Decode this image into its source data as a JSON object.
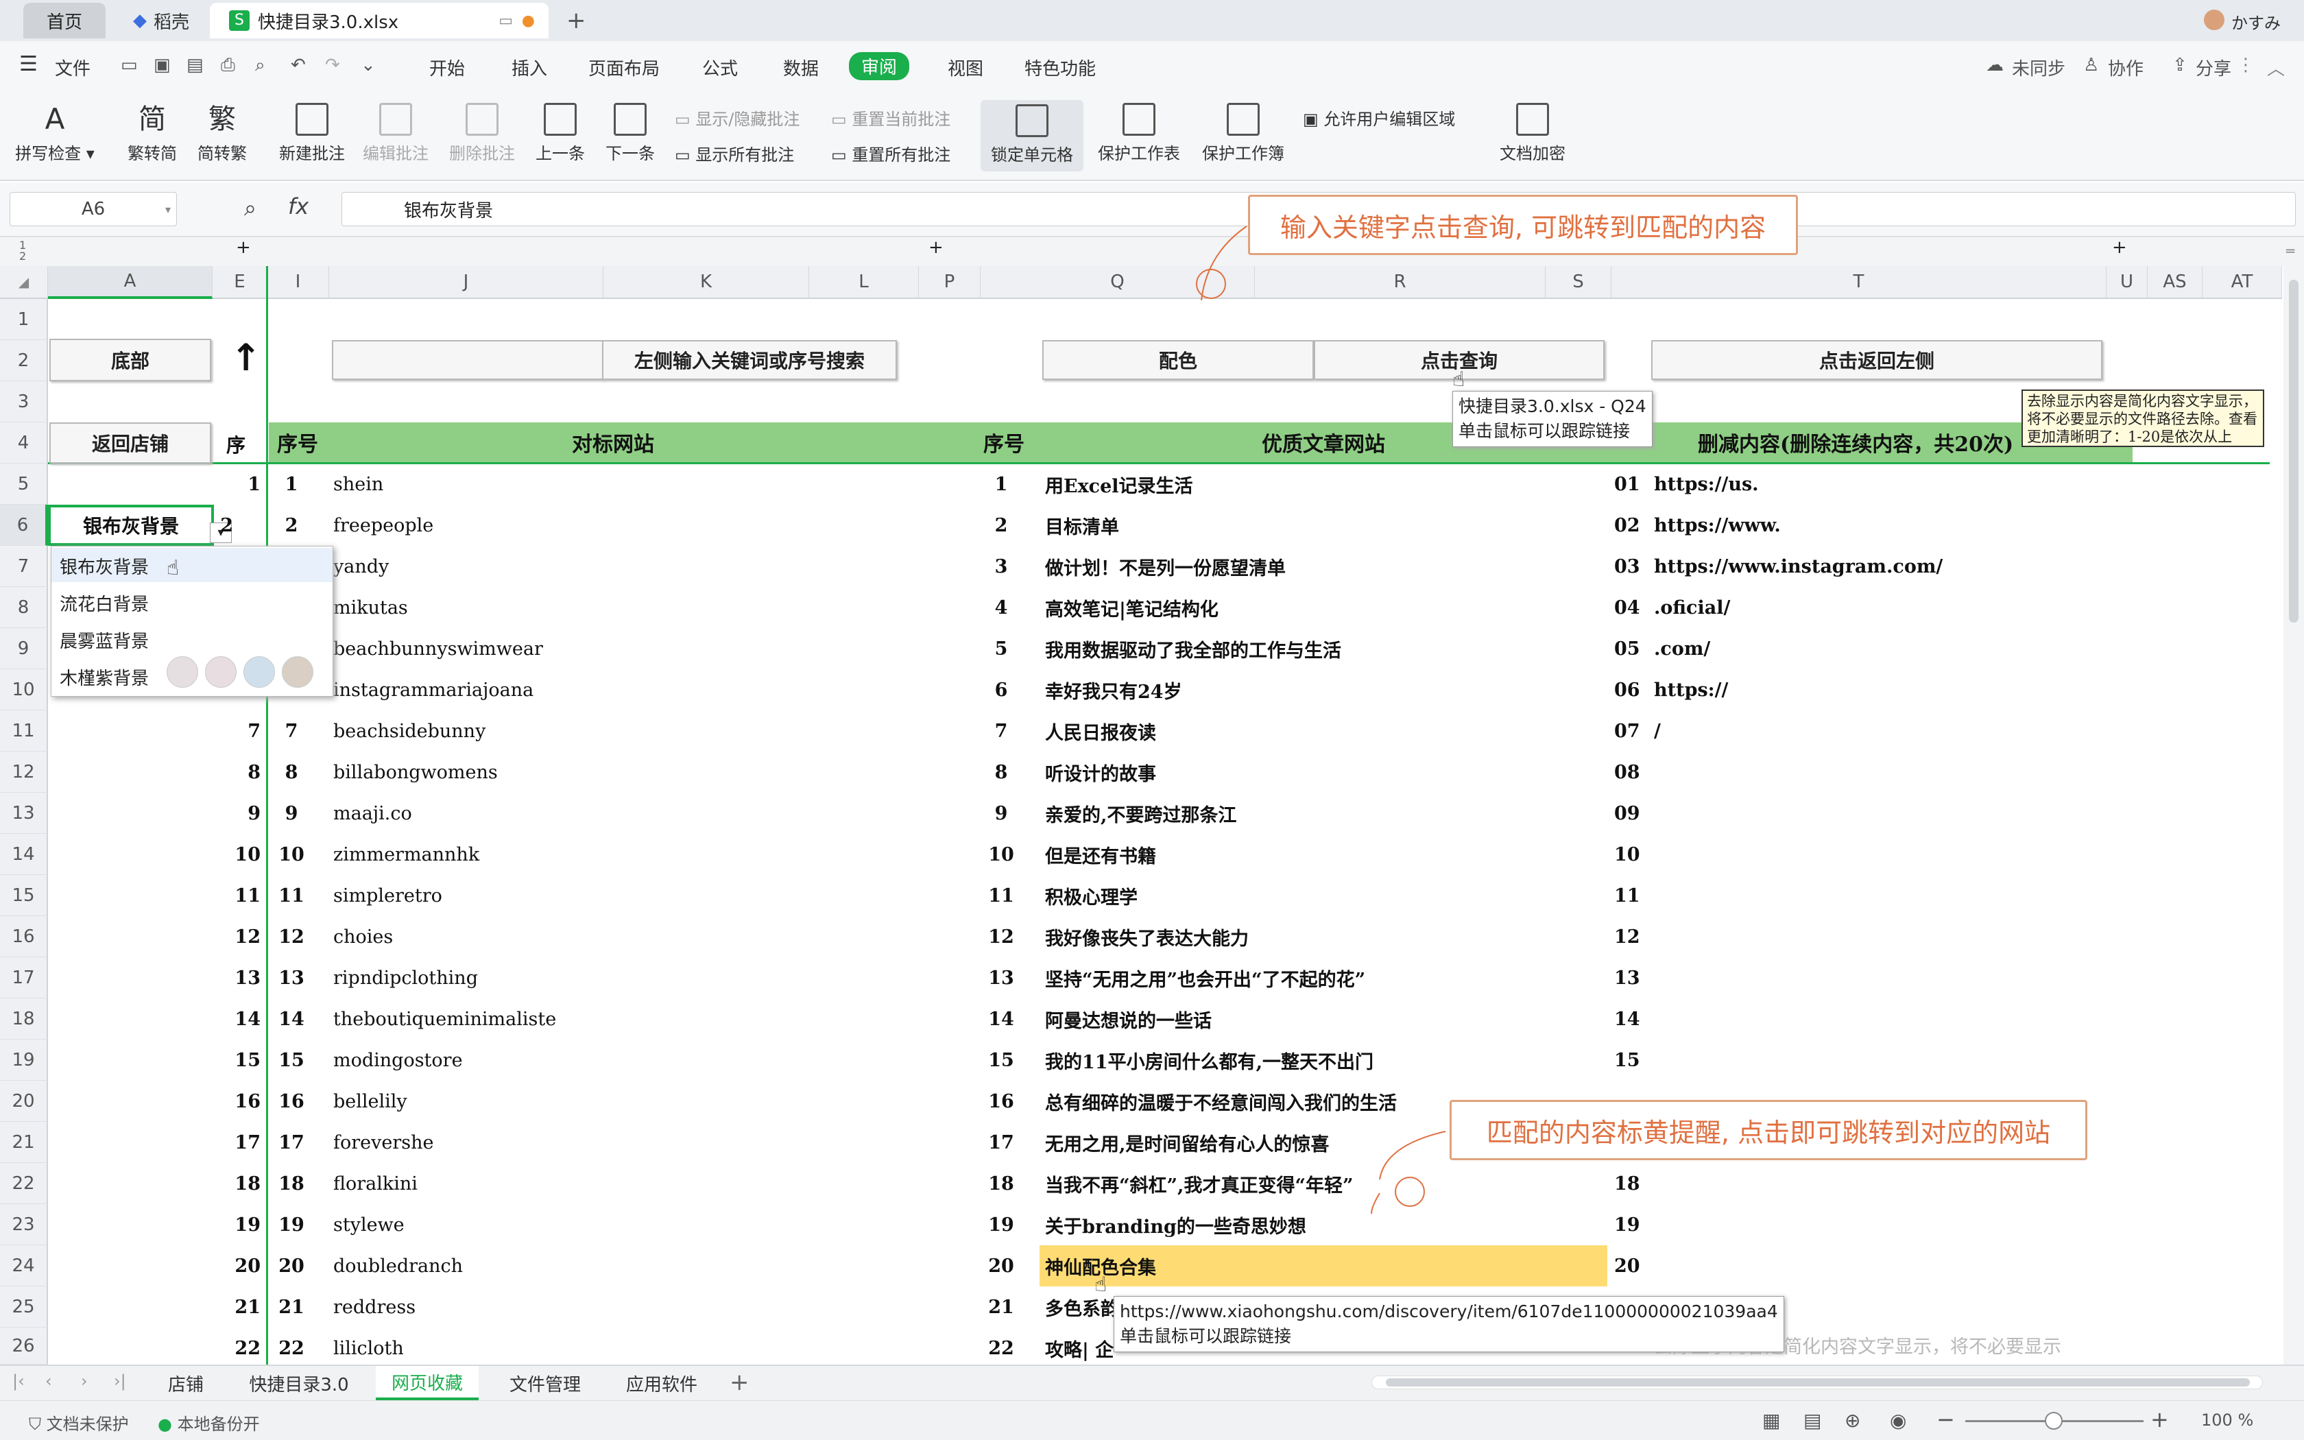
{
  "tabs": {
    "home": "首页",
    "daoke": "稻壳",
    "file": "快捷目录3.0.xlsx",
    "user": "かすみ"
  },
  "menu": {
    "file": "文件",
    "items": [
      "开始",
      "插入",
      "页面布局",
      "公式",
      "数据",
      "审阅",
      "视图",
      "特色功能"
    ],
    "active": "审阅",
    "sync": "未同步",
    "collab": "协作",
    "share": "分享"
  },
  "ribbon": {
    "spell": "拼写检查",
    "t2s": "繁转简",
    "s2t": "简转繁",
    "new_comment": "新建批注",
    "edit_comment": "编辑批注",
    "del_comment": "删除批注",
    "prev": "上一条",
    "next": "下一条",
    "show_hide": "显示/隐藏批注",
    "show_all": "显示所有批注",
    "reset_cur": "重置当前批注",
    "reset_all": "重置所有批注",
    "lock_cell": "锁定单元格",
    "protect_sheet": "保护工作表",
    "protect_book": "保护工作簿",
    "allow_edit": "允许用户编辑区域",
    "encrypt": "文档加密"
  },
  "formula": {
    "namebox": "A6",
    "fx": "fx",
    "value": "银布灰背景"
  },
  "columns": [
    "A",
    "E",
    "I",
    "J",
    "K",
    "L",
    "P",
    "Q",
    "R",
    "S",
    "T",
    "U",
    "AS",
    "AT"
  ],
  "rows": [
    "1",
    "2",
    "3",
    "4",
    "5",
    "6",
    "7",
    "8",
    "9",
    "10",
    "11",
    "12",
    "13",
    "14",
    "15",
    "16",
    "17",
    "18",
    "19",
    "20",
    "21",
    "22",
    "23",
    "24",
    "25",
    "26"
  ],
  "buttons": {
    "bottom": "底部",
    "back_store": "返回店铺",
    "search_left": "左侧输入关键词或序号搜索",
    "color": "配色",
    "query": "点击查询",
    "back_left": "点击返回左侧",
    "arrow": "↑"
  },
  "headers": {
    "seq": "序",
    "seq2": "序号",
    "bench": "对标网站",
    "seq3": "序号",
    "quality": "优质文章网站",
    "delete": "删减内容(删除连续内容，共20次)"
  },
  "selected_cell": "银布灰背景",
  "dropdown": [
    "银布灰背景",
    "流花白背景",
    "晨雾蓝背景",
    "木槿紫背景"
  ],
  "swatches": [
    "#e6dfe2",
    "#e8dde0",
    "#cfe0ec",
    "#d9cfc4"
  ],
  "e_col": [
    "1",
    "2",
    "3",
    "4",
    "5",
    "6",
    "7",
    "8",
    "9",
    "10",
    "11",
    "12",
    "13",
    "14",
    "15",
    "16",
    "17",
    "18",
    "19",
    "20",
    "21",
    "22"
  ],
  "sites": [
    "shein",
    "freepeople",
    "yandy",
    "mikutas",
    "beachbunnyswimwear",
    "instagrammariajoana",
    "beachsidebunny",
    "billabongwomens",
    "maaji.co",
    "zimmermannhk",
    "simpleretro",
    "choies",
    "ripndipclothing",
    "theboutiqueminimaliste",
    "modingostore",
    "bellelily",
    "forevershe",
    "floralkini",
    "stylewe",
    "doubledranch",
    "reddress",
    "lilicloth"
  ],
  "articles": [
    "用Excel记录生活",
    "目标清单",
    "做计划！不是列一份愿望清单",
    "高效笔记|笔记结构化",
    "我用数据驱动了我全部的工作与生活",
    "幸好我只有24岁",
    "人民日报夜读",
    "听设计的故事",
    "亲爱的,不要跨过那条江",
    "但是还有书籍",
    "积极心理学",
    "我好像丧失了表达大能力",
    "坚持“无用之用”也会开出“了不起的花”",
    "阿曼达想说的一些话",
    "我的11平小房间什么都有,一整天不出门",
    "总有细碎的温暖于不经意间闯入我们的生活",
    "无用之用,是时间留给有心人的惊喜",
    "当我不再“斜杠”,我才真正变得“年轻”",
    "关于branding的一些奇思妙想",
    "神仙配色合集",
    "多色系韵",
    "攻略| 企"
  ],
  "s_col": [
    "01",
    "02",
    "03",
    "04",
    "05",
    "06",
    "07",
    "08",
    "09",
    "10",
    "11",
    "12",
    "13",
    "14",
    "15",
    "",
    "",
    "18",
    "19",
    "20"
  ],
  "t_col": [
    "https://us.",
    "https://www.",
    "https://www.instagram.com/",
    ".oficial/",
    ".com/",
    "https://",
    "/"
  ],
  "note": "去除显示内容是简化内容文字显示，将不必要显示的文件路径去除。查看更加清晰明了：1-20是依次从上",
  "note_bottom": "去除显示内容是简化内容文字显示，将不必要显示",
  "callouts": {
    "top": "输入关键字点击查询, 可跳转到匹配的内容",
    "mid": "匹配的内容标黄提醒, 点击即可跳转到对应的网站"
  },
  "tooltips": {
    "q24_file": "快捷目录3.0.xlsx - Q24",
    "track": "单击鼠标可以跟踪链接",
    "url": "https://www.xiaohongshu.com/discovery/item/6107de110000000021039aa4",
    "track2": "单击鼠标可以跟踪链接"
  },
  "sheets": [
    "店铺",
    "快捷目录3.0",
    "网页收藏",
    "文件管理",
    "应用软件"
  ],
  "active_sheet": "网页收藏",
  "status": {
    "protect": "文档未保护",
    "backup": "本地备份开",
    "zoom": "100 %"
  },
  "colors": {
    "accent": "#1aae4c",
    "header_green": "#8fcf85",
    "highlight": "#ffdc73",
    "callout": "#e07040"
  }
}
